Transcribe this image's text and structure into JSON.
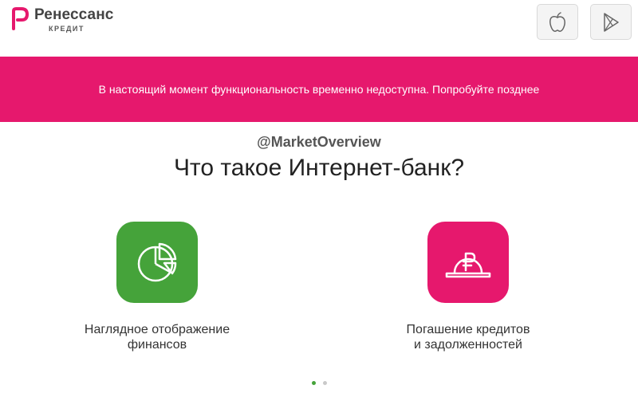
{
  "header": {
    "logo": {
      "name": "Ренессанс",
      "sub": "КРЕДИТ"
    },
    "store_buttons": [
      {
        "icon": "apple-icon"
      },
      {
        "icon": "google-play-icon"
      }
    ]
  },
  "banner": {
    "message": "В настоящий момент функциональность временно недоступна. Попробуйте позднее",
    "color": "#e6186d"
  },
  "watermark": "@MarketOverview",
  "headline": "Что такое Интернет-банк?",
  "features": [
    {
      "icon": "pie-chart-icon",
      "color": "#45a33a",
      "label_lines": [
        "Наглядное отображение",
        "финансов"
      ]
    },
    {
      "icon": "ruble-coin-icon",
      "color": "#e6186d",
      "label_lines": [
        "Погашение кредитов",
        "и задолженностей"
      ]
    }
  ],
  "carousel": {
    "pages": 2,
    "active_page": 1
  }
}
